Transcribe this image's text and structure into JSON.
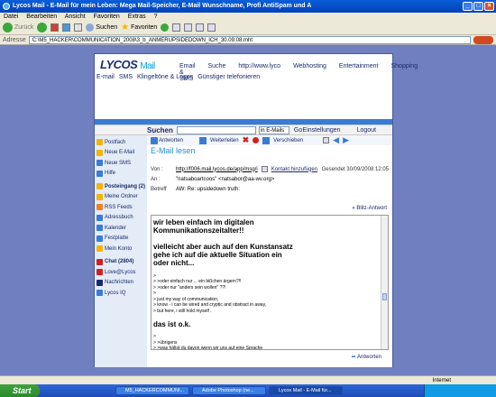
{
  "window": {
    "title": "Lycos Mail - E-Mail für mein Leben: Mega Mail-Speicher, E-Mail Wunschname, Profi AntiSpam und A"
  },
  "menu": [
    "Datei",
    "Bearbeiten",
    "Ansicht",
    "Favoriten",
    "Extras",
    "?"
  ],
  "toolbar": {
    "back": "Zurück",
    "search": "Suchen",
    "favorites": "Favoriten"
  },
  "address": {
    "label": "Adresse",
    "url": "C:\\M5_HACKER\\COMMUNICATION_2008\\3_b_ANMERUPSIDEDOWN_ICH_30.09.08.mht"
  },
  "header": {
    "logo": "LYCOS",
    "logo_suffix": "Mail",
    "topnav": [
      "Email & SMS",
      "Suche",
      "http://www.lyco",
      "Webhosting",
      "Entertainment",
      "Shopping"
    ],
    "subnav": [
      "E-mail",
      "SMS",
      "Klingeltöne & Logos",
      "Günstiger telefonieren"
    ]
  },
  "search": {
    "label": "Suchen",
    "select": "in E-Mails",
    "go": "Go",
    "settings": "Einstellungen",
    "logout": "Logout"
  },
  "sidebar": {
    "items": [
      {
        "label": "Postfach",
        "color": "#f5b400"
      },
      {
        "label": "Neue E-Mail",
        "color": "#f5b400"
      },
      {
        "label": "Neue SMS",
        "color": "#3a7bd5"
      },
      {
        "label": "Hilfe",
        "color": "#3a7bd5"
      },
      {
        "label": "Posteingang (2)",
        "color": "#f5b400",
        "bold": true
      },
      {
        "label": "Meine Ordner",
        "color": "#f5b400"
      },
      {
        "label": "RSS Feeds",
        "color": "#f08020"
      },
      {
        "label": "Adressbuch",
        "color": "#3a7bd5"
      },
      {
        "label": "Kalender",
        "color": "#3a7bd5"
      },
      {
        "label": "Festplatte",
        "color": "#3a7bd5"
      },
      {
        "label": "Mein Konto",
        "color": "#f5b400"
      },
      {
        "label": "Chat (2804)",
        "color": "#d02020",
        "bold": true
      },
      {
        "label": "Love@Lycos",
        "color": "#d02020"
      },
      {
        "label": "Nachrichten",
        "color": "#1a2a6c"
      },
      {
        "label": "Lycos IQ",
        "color": "#3a7bd5"
      }
    ]
  },
  "actions": {
    "answer": "Antworten",
    "forward": "Weiterleiten",
    "move": "Verschieben"
  },
  "email": {
    "title": "E-Mail lesen",
    "from_label": "Von :",
    "from": "http://f006.mail.lycos.de/app/msg/i",
    "contact": "Kontakt hinzufügen",
    "date": "Gesendet 30/09/2008 12:05",
    "to_label": "An :",
    "to": "\"natsaboartcoos\" <natsabor@aa-wv.org>",
    "subject_label": "Betreff",
    "subject": "AW: Re: upsidedown truth:",
    "quick_reply": "» Blitz-Antwort",
    "lines": [
      {
        "t": "wir leben einfach im digitalen",
        "big": true
      },
      {
        "t": "Kommunikationszeitalter!!",
        "big": true
      },
      {
        "t": "",
        "big": true
      },
      {
        "t": "vielleicht aber auch auf den Kunstansatz",
        "big": true
      },
      {
        "t": "gehe ich auf die aktuelle Situation ein",
        "big": true
      },
      {
        "t": "oder nicht...",
        "big": true
      },
      {
        "t": "",
        "big": false
      },
      {
        "t": ">",
        "big": false
      },
      {
        "t": "> >oder einfach nur ... ein bißchen ärgern?!!",
        "big": false
      },
      {
        "t": "> >oder nur \"anders sein wollen\" ??!",
        "big": false
      },
      {
        "t": ">",
        "big": false
      },
      {
        "t": "> just my way of communication,",
        "big": false
      },
      {
        "t": "> know - i can be wired and cryptic and obstract in away,",
        "big": false
      },
      {
        "t": "> but here, i still hold myself .",
        "big": false
      },
      {
        "t": "",
        "big": false
      },
      {
        "t": "das ist o.k.",
        "big": true
      },
      {
        "t": "",
        "big": false
      },
      {
        "t": ">",
        "big": false
      },
      {
        "t": "> >übrigens",
        "big": false
      },
      {
        "t": "> >was hältst du davon wenn wir uns auf eine Sprache",
        "big": false
      },
      {
        "t": "> >einigen?",
        "big": false
      }
    ],
    "bottom_answer": "Antworten"
  },
  "status": {
    "zone": "Internet"
  },
  "taskbar": {
    "start": "Start",
    "tasks": [
      "M5_HACKERCOMMUNI...",
      "Adobe Photoshop (ne...",
      "Lycos Mail - E-Mail für..."
    ]
  }
}
